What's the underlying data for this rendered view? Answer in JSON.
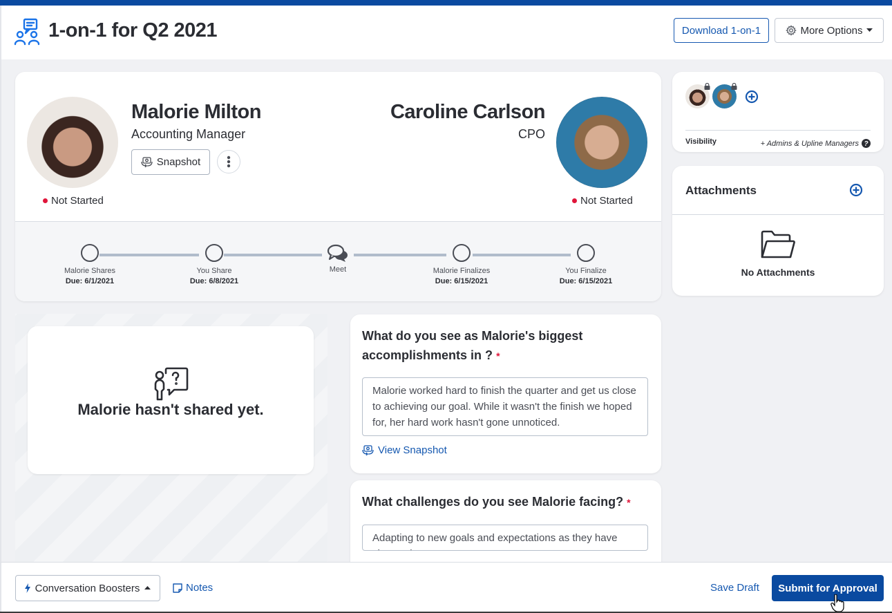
{
  "header": {
    "title": "1-on-1 for Q2 2021",
    "title_icon": "one-on-one-chat-icon",
    "download_label": "Download 1-on-1",
    "more_options_label": "More Options"
  },
  "colors": {
    "brand_blue": "#0a4aa0",
    "link_blue": "#1558b0",
    "status_red": "#e0153a",
    "text_dark": "#2b2d33"
  },
  "participants": {
    "employee": {
      "name": "Malorie Milton",
      "role": "Accounting Manager",
      "status": "Not Started",
      "snapshot_label": "Snapshot"
    },
    "manager": {
      "name": "Caroline Carlson",
      "role": "CPO",
      "status": "Not Started"
    }
  },
  "timeline": {
    "steps": [
      {
        "label": "Malorie Shares",
        "due": "Due: 6/1/2021",
        "icon": "circle-icon"
      },
      {
        "label": "You Share",
        "due": "Due: 6/8/2021",
        "icon": "circle-icon"
      },
      {
        "label": "Meet",
        "due": "",
        "icon": "chat-bubbles-icon"
      },
      {
        "label": "Malorie Finalizes",
        "due": "Due: 6/15/2021",
        "icon": "circle-icon"
      },
      {
        "label": "You Finalize",
        "due": "Due: 6/15/2021",
        "icon": "circle-icon"
      }
    ]
  },
  "visibility": {
    "label": "Visibility",
    "value": "+ Admins & Upline Managers"
  },
  "attachments": {
    "title": "Attachments",
    "empty_text": "No Attachments"
  },
  "not_shared": {
    "text": "Malorie hasn't shared yet."
  },
  "questions": [
    {
      "title": "What do you see as Malorie's biggest accomplishments in ?",
      "required_mark": "*",
      "answer": "Malorie worked hard to finish the quarter and get us close to achieving our goal. While it wasn't the finish we hoped for, her hard work hasn't gone unnoticed.",
      "view_snapshot_label": "View Snapshot"
    },
    {
      "title": "What challenges do you see Malorie facing?",
      "required_mark": "*",
      "answer": "Adapting to new goals and expectations as they have changed."
    }
  ],
  "footer": {
    "boosters_label": "Conversation Boosters",
    "notes_label": "Notes",
    "save_draft_label": "Save Draft",
    "submit_label": "Submit for Approval"
  }
}
